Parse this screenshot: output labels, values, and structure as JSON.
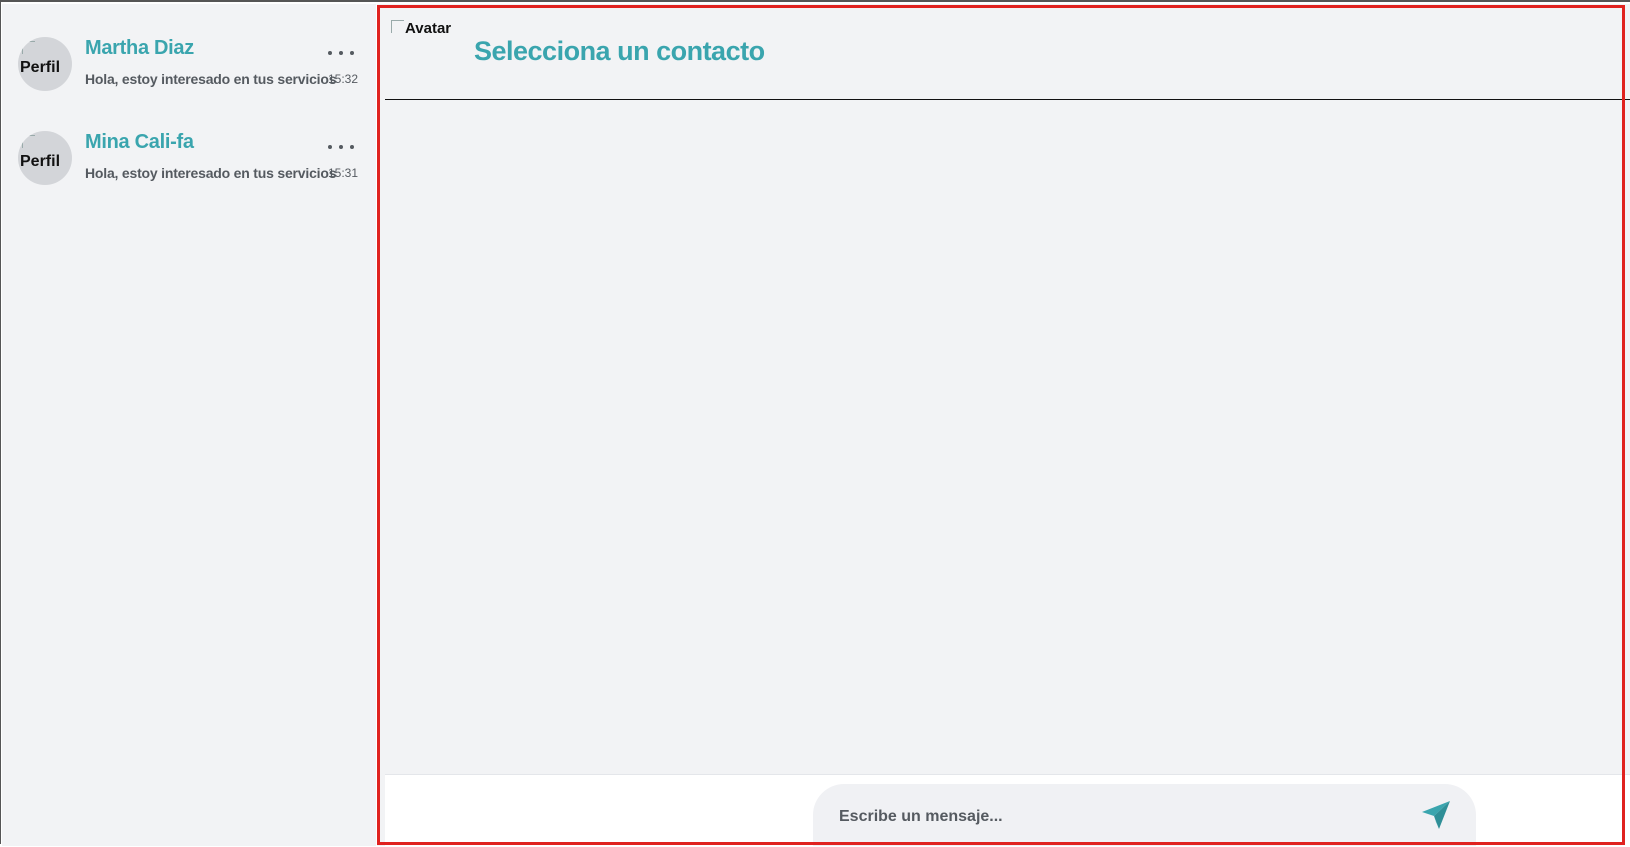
{
  "contacts": [
    {
      "avatar_alt": "Perfil",
      "name": "Martha Diaz",
      "preview": "Hola, estoy interesado en tus servicios",
      "time": "15:32"
    },
    {
      "avatar_alt": "Perfil",
      "name": "Mina Cali-fa",
      "preview": "Hola, estoy interesado en tus servicios",
      "time": "15:31"
    }
  ],
  "chat": {
    "header_avatar_alt": "Avatar",
    "title": "Selecciona un contacto"
  },
  "composer": {
    "placeholder": "Escribe un mensaje...",
    "send_icon": "send-icon"
  },
  "colors": {
    "accent": "#3aa5ae",
    "panel_bg": "#f2f3f5",
    "highlight_outline": "#e0221f"
  }
}
